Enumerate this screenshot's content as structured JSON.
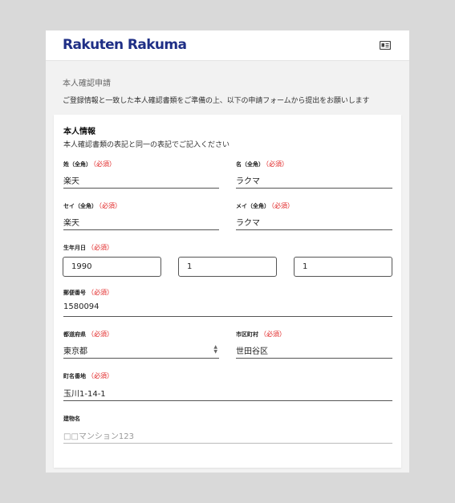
{
  "header": {
    "logo_text": "Rakuten Rakuma",
    "menu_icon": "id-card-icon"
  },
  "intro": {
    "title": "本人確認申請",
    "text": "ご登録情報と一致した本人確認書類をご準備の上、以下の申請フォームから提出をお願いします"
  },
  "form": {
    "section_title": "本人情報",
    "section_sub": "本人確認書類の表記と同一の表記でご記入ください",
    "required_label": "（必須）",
    "last_name": {
      "label": "姓（全角）",
      "value": "楽天"
    },
    "first_name": {
      "label": "名（全角）",
      "value": "ラクマ"
    },
    "last_name_kana": {
      "label": "セイ（全角）",
      "value": "楽天"
    },
    "first_name_kana": {
      "label": "メイ（全角）",
      "value": "ラクマ"
    },
    "birthdate": {
      "label": "生年月日",
      "year": "1990",
      "month": "1",
      "day": "1"
    },
    "postal_code": {
      "label": "郵便番号",
      "value": "1580094"
    },
    "prefecture": {
      "label": "都道府県",
      "value": "東京都"
    },
    "city": {
      "label": "市区町村",
      "value": "世田谷区"
    },
    "street": {
      "label": "町名番地",
      "value": "玉川1-14-1"
    },
    "building": {
      "label": "建物名",
      "placeholder": "□□マンション123"
    }
  },
  "colors": {
    "brand": "#1f2f86",
    "required": "#e02020",
    "background": "#f2f2f2"
  }
}
